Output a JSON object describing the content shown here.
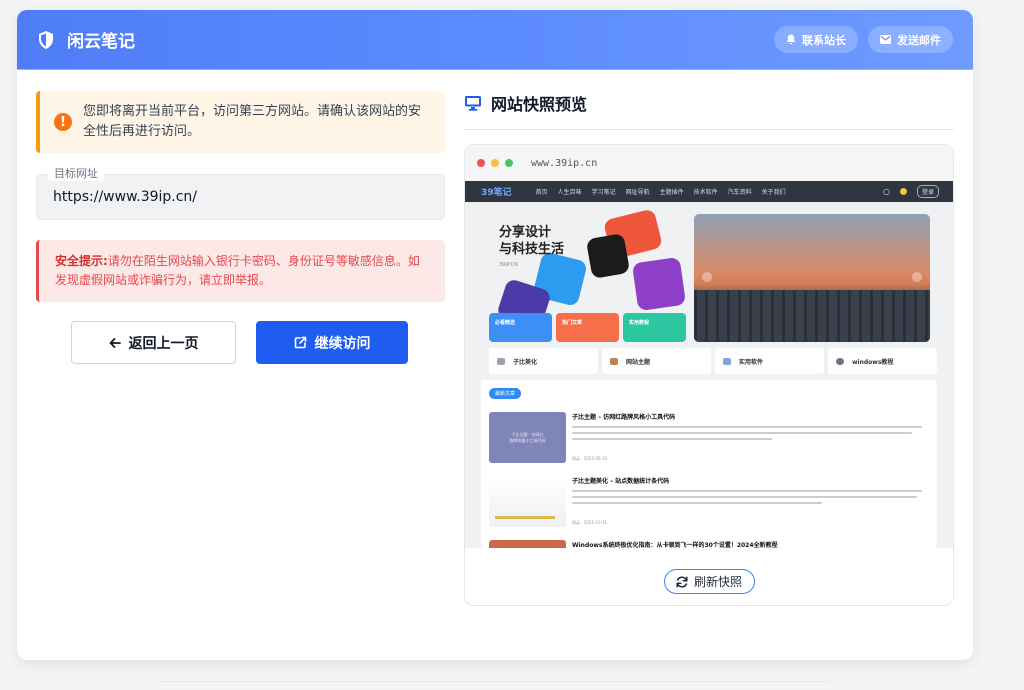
{
  "header": {
    "brand": "闲云笔记",
    "contact_label": "联系站长",
    "email_label": "发送邮件"
  },
  "notice": {
    "text": "您即将离开当前平台，访问第三方网站。请确认该网站的安全性后再进行访问。"
  },
  "target": {
    "label": "目标网址",
    "url": "https://www.39ip.cn/"
  },
  "alert": {
    "title": "安全提示:",
    "text": "请勿在陌生网站输入银行卡密码、身份证号等敏感信息。如发现虚假网站或诈骗行为，请立即举报。"
  },
  "actions": {
    "back_label": "返回上一页",
    "continue_label": "继续访问"
  },
  "preview": {
    "title": "网站快照预览",
    "address": "www.39ip.cn",
    "refresh_label": "刷新快照",
    "site": {
      "logo": "39笔记",
      "nav": [
        "首页",
        "人生百味",
        "学习笔记",
        "网址导航",
        "主题插件",
        "技术软件",
        "汽车资料",
        "关于我们"
      ],
      "login": "登录",
      "hero_title_1": "分享设计",
      "hero_title_2": "与科技生活",
      "hero_sub": "39IP.CN",
      "tiles": [
        "必看精选",
        "热门文章",
        "实用教程"
      ],
      "categories": [
        "子比美化",
        "网站主题",
        "实用软件",
        "windows教程"
      ],
      "posts_tag": "最新文章",
      "posts": [
        {
          "title": "子比主题 – 仿网红路牌风格小工具代码",
          "thumb": "子比主题 - 仿网红\n路牌风格小工具代码",
          "meta": "闲云 · 2025-05-10"
        },
        {
          "title": "子比主题美化 – 站点数据统计条代码",
          "meta": "闲云 · 2025-10-31"
        },
        {
          "title": "Windows系统终极优化指南：从卡顿到飞一样的30个设置！2024全新教程"
        }
      ]
    }
  },
  "colors": {
    "primary": "#1f5df0",
    "warning": "#f59e0b",
    "danger": "#e5484d"
  }
}
